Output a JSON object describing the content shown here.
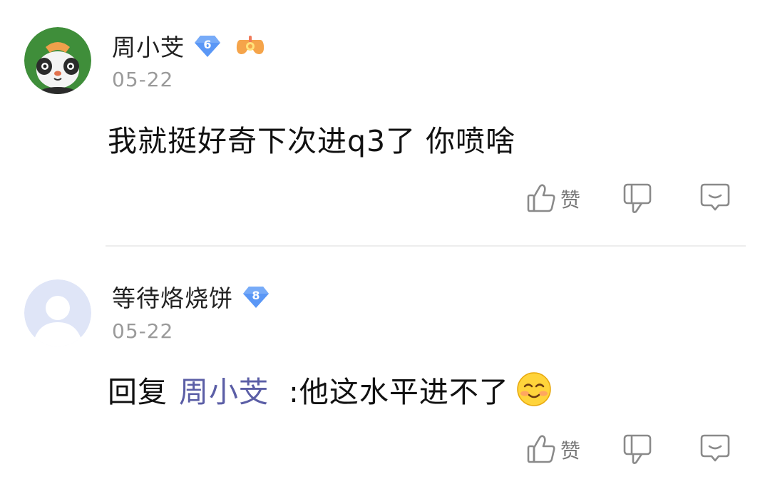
{
  "comments": [
    {
      "username": "周小芠",
      "level": "6",
      "date": "05-22",
      "text": "我就挺好奇下次进q3了 你喷啥",
      "like_label": "赞",
      "avatar_icon": "panda-avatar-icon",
      "level_color": "#4f8ff7"
    },
    {
      "username": "等待烙烧饼",
      "level": "8",
      "date": "05-22",
      "reply_prefix": "回复",
      "reply_to": "周小芠",
      "text": ":他这水平进不了",
      "emoji_icon": "shy-smile-emoji-icon",
      "like_label": "赞",
      "avatar_icon": "default-user-avatar-icon",
      "level_color": "#4f8ff7"
    }
  ]
}
